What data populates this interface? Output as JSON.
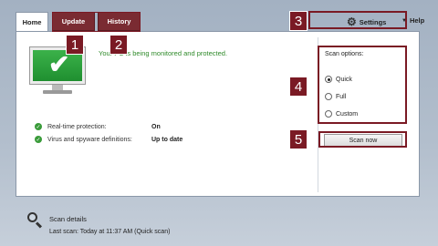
{
  "tabs": [
    {
      "label": "Home"
    },
    {
      "label": "Update"
    },
    {
      "label": "History"
    }
  ],
  "header": {
    "settings_label": "Settings",
    "help_label": "Help"
  },
  "status": {
    "message": "Your PC is being monitored and protected.",
    "rows": [
      {
        "label": "Real-time protection:",
        "value": "On"
      },
      {
        "label": "Virus and spyware definitions:",
        "value": "Up to date"
      }
    ]
  },
  "scan_options": {
    "title": "Scan options:",
    "options": [
      {
        "label": "Quick",
        "selected": true
      },
      {
        "label": "Full",
        "selected": false
      },
      {
        "label": "Custom",
        "selected": false
      }
    ],
    "scan_button": "Scan now"
  },
  "scan_details": {
    "title": "Scan details",
    "last_scan": "Last scan:  Today at 11:37 AM (Quick scan)"
  },
  "callouts": [
    "1",
    "2",
    "3",
    "4",
    "5"
  ],
  "colors": {
    "callout": "#7a1a24",
    "tab_active_bg": "#7a2b32",
    "status_green": "#2f8a2a"
  }
}
